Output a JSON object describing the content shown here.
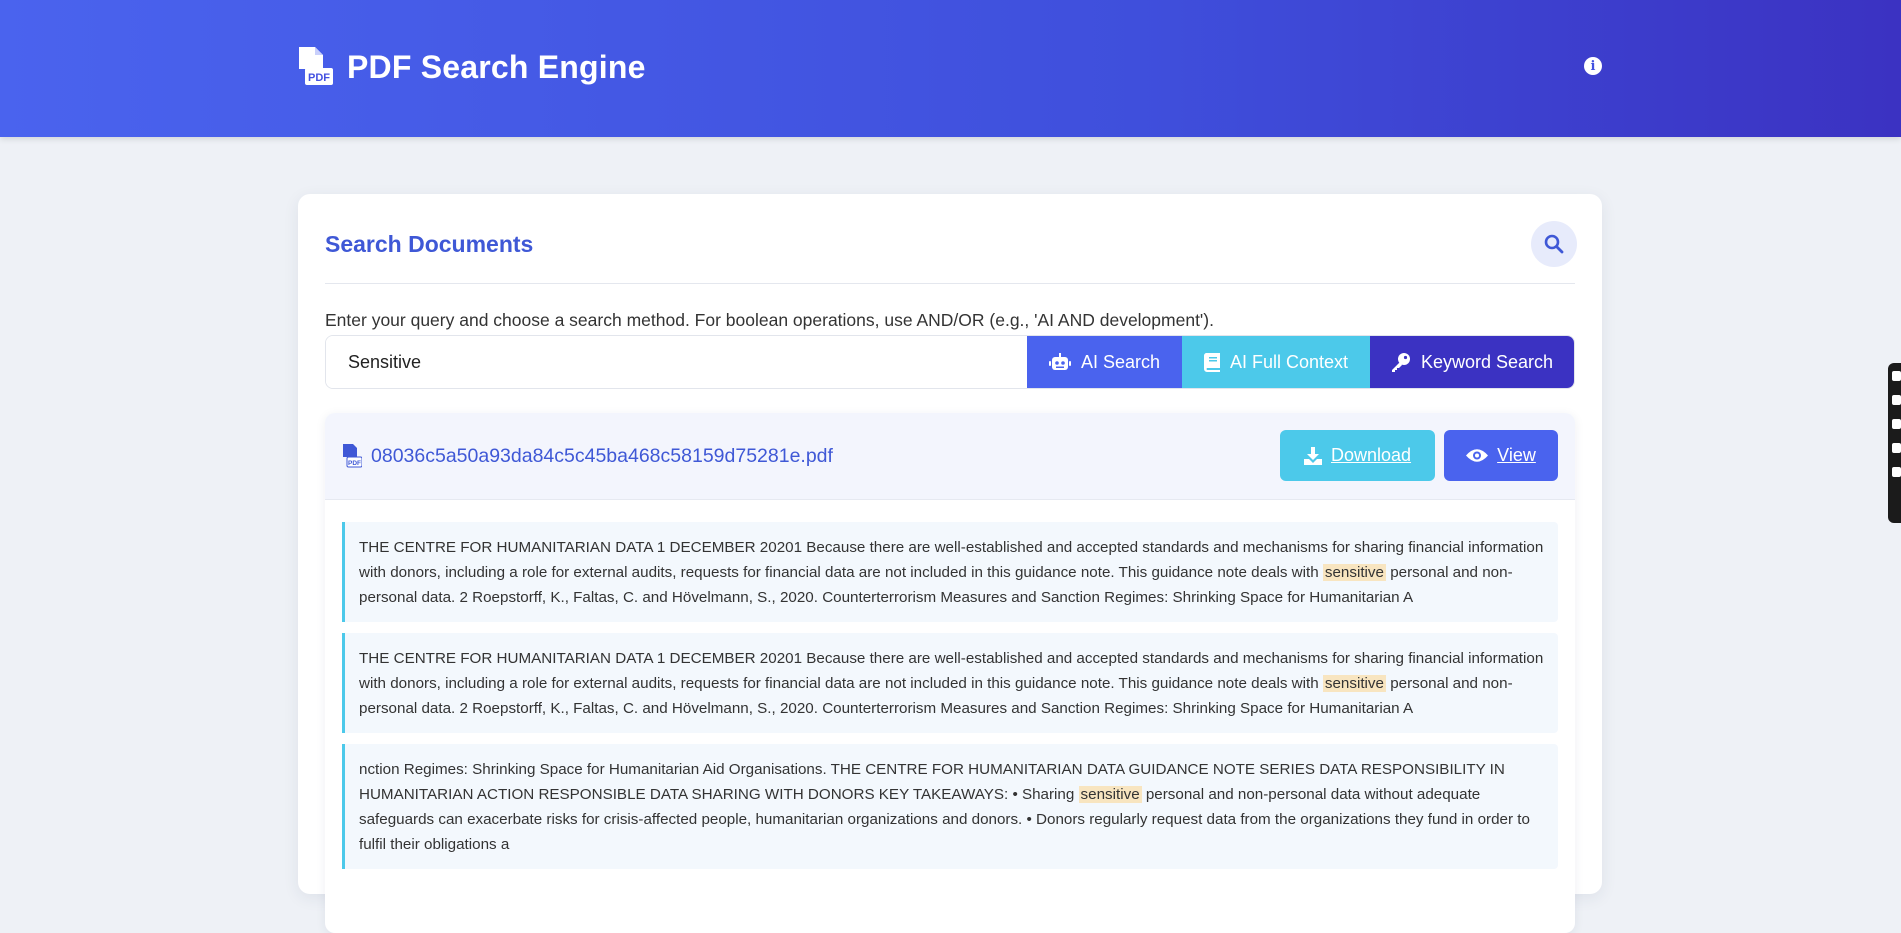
{
  "header": {
    "title": "PDF Search Engine",
    "logo_icon": "pdf-file-icon",
    "info_icon": "info-icon"
  },
  "search": {
    "title": "Search Documents",
    "instructions": "Enter your query and choose a search method. For boolean operations, use AND/OR (e.g., 'AI AND development').",
    "query_value": "Sensitive",
    "buttons": {
      "ai": "AI Search",
      "full_context": "AI Full Context",
      "keyword": "Keyword Search"
    }
  },
  "result": {
    "file_name": "08036c5a50a93da84c5c45ba468c58159d75281e.pdf",
    "download_label": "Download",
    "view_label": "View",
    "snippets": [
      {
        "before": "THE CENTRE FOR HUMANITARIAN DATA 1 DECEMBER 20201 Because there are well-established and accepted standards and mechanisms for sharing financial information with donors, including a role for external audits, requests for financial data are not included in this guidance note. This guidance note deals with ",
        "highlight": "sensitive",
        "after": " personal and non-personal data. 2 Roepstorff, K., Faltas, C. and Hövelmann, S., 2020. Counterterrorism Measures and Sanction Regimes: Shrinking Space for Humanitarian A"
      },
      {
        "before": "THE CENTRE FOR HUMANITARIAN DATA 1 DECEMBER 20201 Because there are well-established and accepted standards and mechanisms for sharing financial information with donors, including a role for external audits, requests for financial data are not included in this guidance note. This guidance note deals with ",
        "highlight": "sensitive",
        "after": " personal and non-personal data. 2 Roepstorff, K., Faltas, C. and Hövelmann, S., 2020. Counterterrorism Measures and Sanction Regimes: Shrinking Space for Humanitarian A"
      },
      {
        "before": "nction Regimes: Shrinking Space for Humanitarian Aid Organisations. THE CENTRE FOR HUMANITARIAN DATA GUIDANCE NOTE SERIES DATA RESPONSIBILITY IN HUMANITARIAN ACTION RESPONSIBLE DATA SHARING WITH DONORS KEY TAKEAWAYS: • Sharing ",
        "highlight": "sensitive",
        "after": " personal and non-personal data without adequate safeguards can exacerbate risks for crisis-affected people, humanitarian organizations and donors. • Donors regularly request data from the organizations they fund in order to fulfil their obligations a"
      }
    ]
  },
  "colors": {
    "primary": "#4a63ee",
    "secondary": "#4cc9ea",
    "dark": "#3b32c2",
    "highlight": "#f8e5c0"
  }
}
